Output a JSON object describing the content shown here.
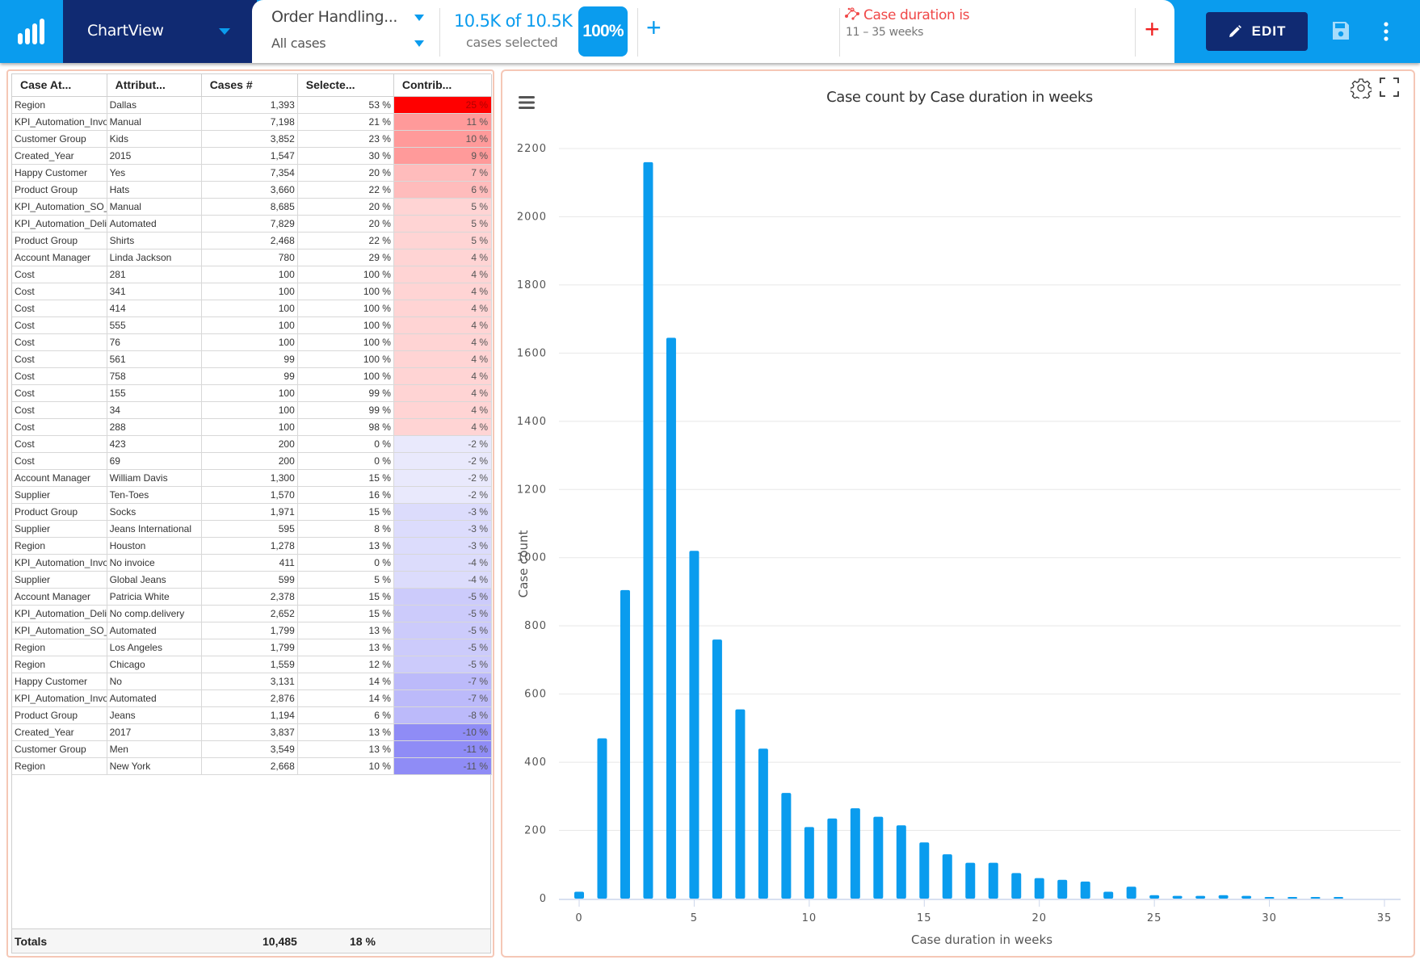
{
  "topbar": {
    "logo_icon": "bar-chart-logo-icon",
    "app_name": "ChartView",
    "process_name": "Order Handling...",
    "case_filter": "All cases",
    "cases_count": "10.5K of 10.5K",
    "cases_label": "cases selected",
    "selected_percent": "100%",
    "filter_title": "Case duration is",
    "filter_value": "11 – 35 weeks",
    "filter_icon": "process-network-icon",
    "edit_label": "EDIT",
    "colors": {
      "brand": "#0a9cee",
      "dark": "#102a72",
      "filter": "#f04848"
    }
  },
  "table": {
    "columns": [
      "Case At...",
      "Attribut...",
      "Cases #",
      "Selecte...",
      "Contrib..."
    ],
    "rows": [
      {
        "attr": "Region",
        "value": "Dallas",
        "cases": "1,393",
        "selected": "53 %",
        "contrib": "25 %",
        "contrib_num": 25
      },
      {
        "attr": "KPI_Automation_Invo",
        "value": "Manual",
        "cases": "7,198",
        "selected": "21 %",
        "contrib": "11 %",
        "contrib_num": 11
      },
      {
        "attr": "Customer Group",
        "value": "Kids",
        "cases": "3,852",
        "selected": "23 %",
        "contrib": "10 %",
        "contrib_num": 10
      },
      {
        "attr": "Created_Year",
        "value": "2015",
        "cases": "1,547",
        "selected": "30 %",
        "contrib": "9 %",
        "contrib_num": 9
      },
      {
        "attr": "Happy Customer",
        "value": "Yes",
        "cases": "7,354",
        "selected": "20 %",
        "contrib": "7 %",
        "contrib_num": 7
      },
      {
        "attr": "Product Group",
        "value": "Hats",
        "cases": "3,660",
        "selected": "22 %",
        "contrib": "6 %",
        "contrib_num": 6
      },
      {
        "attr": "KPI_Automation_SO_(",
        "value": "Manual",
        "cases": "8,685",
        "selected": "20 %",
        "contrib": "5 %",
        "contrib_num": 5
      },
      {
        "attr": "KPI_Automation_Deliv",
        "value": "Automated",
        "cases": "7,829",
        "selected": "20 %",
        "contrib": "5 %",
        "contrib_num": 5
      },
      {
        "attr": "Product Group",
        "value": "Shirts",
        "cases": "2,468",
        "selected": "22 %",
        "contrib": "5 %",
        "contrib_num": 5
      },
      {
        "attr": "Account Manager",
        "value": "Linda Jackson",
        "cases": "780",
        "selected": "29 %",
        "contrib": "4 %",
        "contrib_num": 4
      },
      {
        "attr": "Cost",
        "value": "281",
        "cases": "100",
        "selected": "100 %",
        "contrib": "4 %",
        "contrib_num": 4
      },
      {
        "attr": "Cost",
        "value": "341",
        "cases": "100",
        "selected": "100 %",
        "contrib": "4 %",
        "contrib_num": 4
      },
      {
        "attr": "Cost",
        "value": "414",
        "cases": "100",
        "selected": "100 %",
        "contrib": "4 %",
        "contrib_num": 4
      },
      {
        "attr": "Cost",
        "value": "555",
        "cases": "100",
        "selected": "100 %",
        "contrib": "4 %",
        "contrib_num": 4
      },
      {
        "attr": "Cost",
        "value": "76",
        "cases": "100",
        "selected": "100 %",
        "contrib": "4 %",
        "contrib_num": 4
      },
      {
        "attr": "Cost",
        "value": "561",
        "cases": "99",
        "selected": "100 %",
        "contrib": "4 %",
        "contrib_num": 4
      },
      {
        "attr": "Cost",
        "value": "758",
        "cases": "99",
        "selected": "100 %",
        "contrib": "4 %",
        "contrib_num": 4
      },
      {
        "attr": "Cost",
        "value": "155",
        "cases": "100",
        "selected": "99 %",
        "contrib": "4 %",
        "contrib_num": 4
      },
      {
        "attr": "Cost",
        "value": "34",
        "cases": "100",
        "selected": "99 %",
        "contrib": "4 %",
        "contrib_num": 4
      },
      {
        "attr": "Cost",
        "value": "288",
        "cases": "100",
        "selected": "98 %",
        "contrib": "4 %",
        "contrib_num": 4
      },
      {
        "attr": "Cost",
        "value": "423",
        "cases": "200",
        "selected": "0 %",
        "contrib": "-2 %",
        "contrib_num": -2
      },
      {
        "attr": "Cost",
        "value": "69",
        "cases": "200",
        "selected": "0 %",
        "contrib": "-2 %",
        "contrib_num": -2
      },
      {
        "attr": "Account Manager",
        "value": "William Davis",
        "cases": "1,300",
        "selected": "15 %",
        "contrib": "-2 %",
        "contrib_num": -2
      },
      {
        "attr": "Supplier",
        "value": "Ten-Toes",
        "cases": "1,570",
        "selected": "16 %",
        "contrib": "-2 %",
        "contrib_num": -2
      },
      {
        "attr": "Product Group",
        "value": "Socks",
        "cases": "1,971",
        "selected": "15 %",
        "contrib": "-3 %",
        "contrib_num": -3
      },
      {
        "attr": "Supplier",
        "value": "Jeans International",
        "cases": "595",
        "selected": "8 %",
        "contrib": "-3 %",
        "contrib_num": -3
      },
      {
        "attr": "Region",
        "value": "Houston",
        "cases": "1,278",
        "selected": "13 %",
        "contrib": "-3 %",
        "contrib_num": -3
      },
      {
        "attr": "KPI_Automation_Invo",
        "value": "No invoice",
        "cases": "411",
        "selected": "0 %",
        "contrib": "-4 %",
        "contrib_num": -4
      },
      {
        "attr": "Supplier",
        "value": "Global Jeans",
        "cases": "599",
        "selected": "5 %",
        "contrib": "-4 %",
        "contrib_num": -4
      },
      {
        "attr": "Account Manager",
        "value": "Patricia White",
        "cases": "2,378",
        "selected": "15 %",
        "contrib": "-5 %",
        "contrib_num": -5
      },
      {
        "attr": "KPI_Automation_Deliv",
        "value": "No comp.delivery",
        "cases": "2,652",
        "selected": "15 %",
        "contrib": "-5 %",
        "contrib_num": -5
      },
      {
        "attr": "KPI_Automation_SO_(",
        "value": "Automated",
        "cases": "1,799",
        "selected": "13 %",
        "contrib": "-5 %",
        "contrib_num": -5
      },
      {
        "attr": "Region",
        "value": "Los Angeles",
        "cases": "1,799",
        "selected": "13 %",
        "contrib": "-5 %",
        "contrib_num": -5
      },
      {
        "attr": "Region",
        "value": "Chicago",
        "cases": "1,559",
        "selected": "12 %",
        "contrib": "-5 %",
        "contrib_num": -5
      },
      {
        "attr": "Happy Customer",
        "value": "No",
        "cases": "3,131",
        "selected": "14 %",
        "contrib": "-7 %",
        "contrib_num": -7
      },
      {
        "attr": "KPI_Automation_Invo",
        "value": "Automated",
        "cases": "2,876",
        "selected": "14 %",
        "contrib": "-7 %",
        "contrib_num": -7
      },
      {
        "attr": "Product Group",
        "value": "Jeans",
        "cases": "1,194",
        "selected": "6 %",
        "contrib": "-8 %",
        "contrib_num": -8
      },
      {
        "attr": "Created_Year",
        "value": "2017",
        "cases": "3,837",
        "selected": "13 %",
        "contrib": "-10 %",
        "contrib_num": -10
      },
      {
        "attr": "Customer Group",
        "value": "Men",
        "cases": "3,549",
        "selected": "13 %",
        "contrib": "-11 %",
        "contrib_num": -11
      },
      {
        "attr": "Region",
        "value": "New York",
        "cases": "2,668",
        "selected": "10 %",
        "contrib": "-11 %",
        "contrib_num": -11
      }
    ],
    "totals": {
      "label": "Totals",
      "cases": "10,485",
      "selected": "18 %"
    }
  },
  "chart_data": {
    "type": "bar",
    "title": "Case count by Case duration in weeks",
    "xlabel": "Case duration in weeks",
    "ylabel": "Case count",
    "x": [
      0,
      1,
      2,
      3,
      4,
      5,
      6,
      7,
      8,
      9,
      10,
      11,
      12,
      13,
      14,
      15,
      16,
      17,
      18,
      19,
      20,
      21,
      22,
      23,
      24,
      25,
      26,
      27,
      28,
      29,
      30,
      31,
      32,
      33
    ],
    "values": [
      20,
      470,
      905,
      2160,
      1645,
      1020,
      760,
      555,
      440,
      310,
      210,
      235,
      265,
      240,
      215,
      165,
      130,
      105,
      105,
      75,
      60,
      55,
      50,
      20,
      35,
      10,
      8,
      8,
      10,
      8,
      2,
      3,
      2,
      3
    ],
    "xlim": [
      0,
      35
    ],
    "ylim": [
      0,
      2200
    ],
    "xticks": [
      0,
      5,
      10,
      15,
      20,
      25,
      30,
      35
    ],
    "yticks": [
      0,
      200,
      400,
      600,
      800,
      1000,
      1200,
      1400,
      1600,
      1800,
      2000,
      2200
    ],
    "grid": true,
    "bar_color": "#0a9cee"
  }
}
